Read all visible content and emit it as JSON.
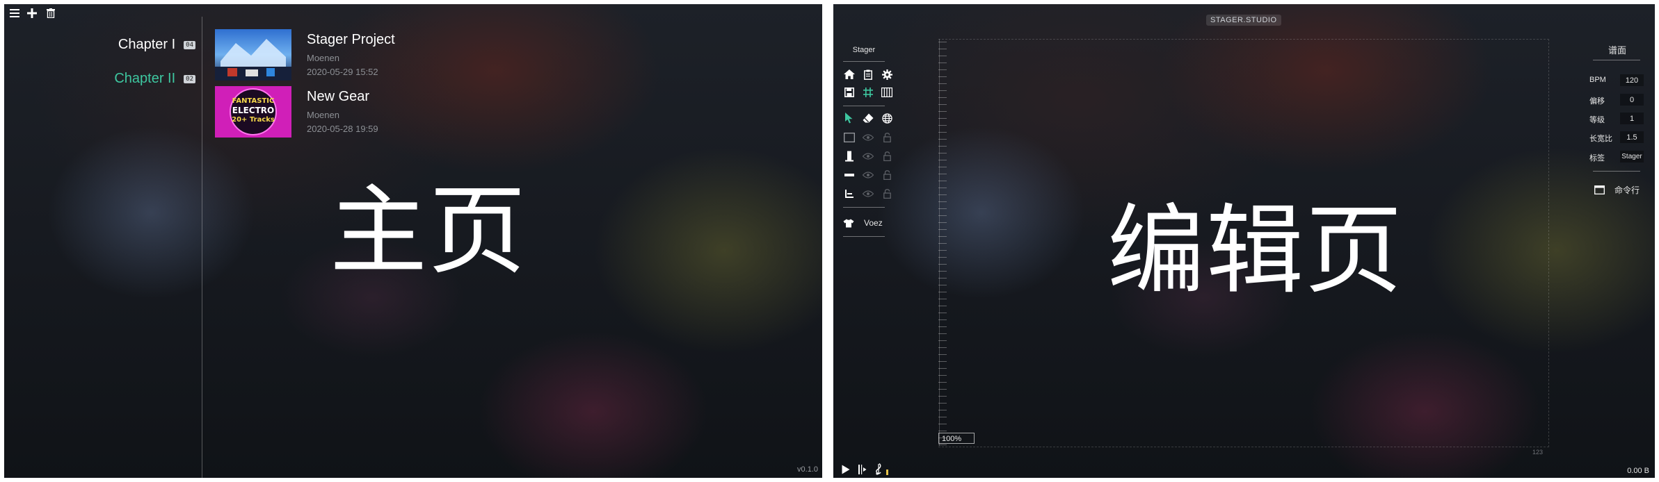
{
  "home": {
    "big_label": "主页",
    "version": "v0.1.0",
    "chapters": [
      {
        "name": "Chapter I",
        "count": "04",
        "active": false
      },
      {
        "name": "Chapter II",
        "count": "02",
        "active": true
      }
    ],
    "tracks": [
      {
        "title": "Stager Project",
        "artist": "Moenen",
        "date": "2020-05-29 15:52"
      },
      {
        "title": "New Gear",
        "artist": "Moenen",
        "date": "2020-05-28 19:59",
        "cover_text": [
          "FANTASTIC",
          "ELECTRO",
          "20+ Tracks"
        ]
      }
    ]
  },
  "editor": {
    "big_label": "编辑页",
    "app_badge": "STAGER.STUDIO",
    "project_name": "Stager",
    "skin_label": "Voez",
    "zoom": "100%",
    "timeline_number": "123",
    "size_readout": "0.00 B",
    "panel_title": "谱面",
    "properties": [
      {
        "label": "BPM",
        "value": "120"
      },
      {
        "label": "偏移",
        "value": "0"
      },
      {
        "label": "等级",
        "value": "1"
      },
      {
        "label": "长宽比",
        "value": "1.5"
      },
      {
        "label": "标签",
        "value": "Stager"
      }
    ],
    "command_label": "命令行"
  },
  "colors": {
    "accent_green": "#3ec7a0",
    "text": "#e6e6e6",
    "muted": "#8c8f94"
  }
}
